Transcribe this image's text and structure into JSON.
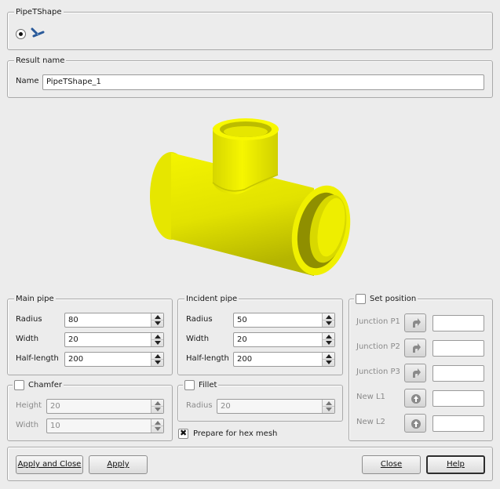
{
  "pipe_tshape": {
    "title": "PipeTShape"
  },
  "result": {
    "title": "Result name",
    "name_label": "Name",
    "name_value": "PipeTShape_1"
  },
  "main_pipe": {
    "title": "Main pipe",
    "radius_label": "Radius",
    "radius": "80",
    "width_label": "Width",
    "width": "20",
    "half_length_label": "Half-length",
    "half_length": "200"
  },
  "incident_pipe": {
    "title": "Incident pipe",
    "radius_label": "Radius",
    "radius": "50",
    "width_label": "Width",
    "width": "20",
    "half_length_label": "Half-length",
    "half_length": "200"
  },
  "chamfer": {
    "title": "Chamfer",
    "height_label": "Height",
    "height": "20",
    "width_label": "Width",
    "width": "10"
  },
  "fillet": {
    "title": "Fillet",
    "radius_label": "Radius",
    "radius": "20"
  },
  "hex_mesh": {
    "label": "Prepare for hex mesh"
  },
  "set_position": {
    "title": "Set position",
    "junction_p1": "Junction P1",
    "junction_p2": "Junction P2",
    "junction_p3": "Junction P3",
    "new_l1": "New L1",
    "new_l2": "New L2"
  },
  "footer": {
    "apply_close": "Apply and Close",
    "apply": "Apply",
    "close": "Close",
    "help": "Help"
  },
  "colors": {
    "pipe_yellow": "#e8e800",
    "pipe_shadow": "#8f8f00",
    "window_bg": "#ececec"
  }
}
